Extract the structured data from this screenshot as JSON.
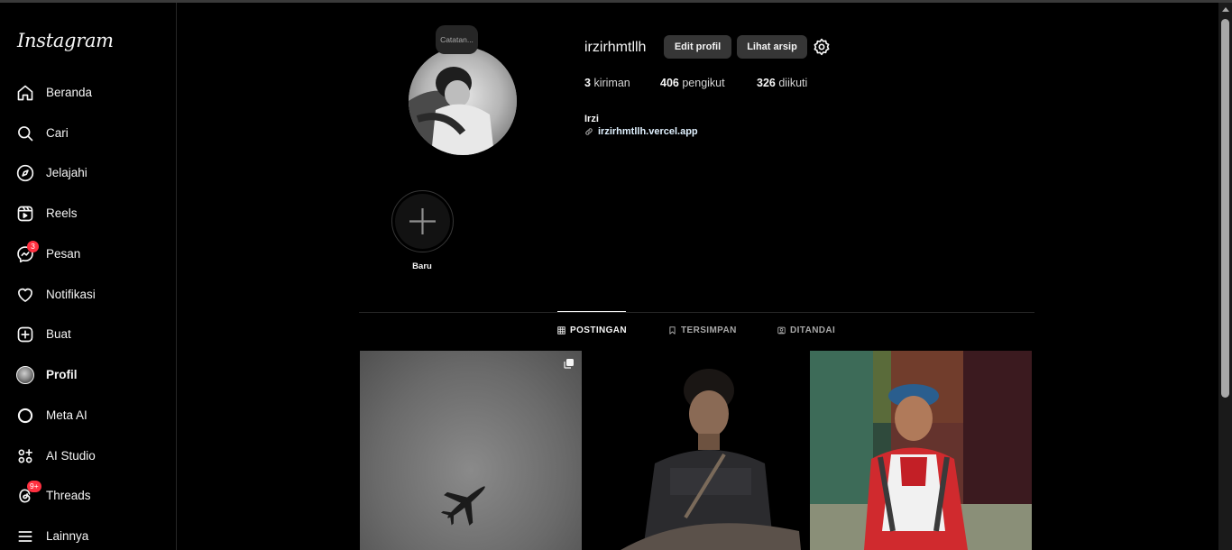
{
  "sidebar": {
    "logo": "Instagram",
    "items": [
      {
        "label": "Beranda",
        "icon": "home-icon"
      },
      {
        "label": "Cari",
        "icon": "search-icon"
      },
      {
        "label": "Jelajahi",
        "icon": "compass-icon"
      },
      {
        "label": "Reels",
        "icon": "reels-icon"
      },
      {
        "label": "Pesan",
        "icon": "messenger-icon",
        "badge": "3"
      },
      {
        "label": "Notifikasi",
        "icon": "heart-icon"
      },
      {
        "label": "Buat",
        "icon": "plus-square-icon"
      },
      {
        "label": "Profil",
        "icon": "avatar"
      },
      {
        "label": "Meta AI",
        "icon": "meta-ai-ring-icon"
      },
      {
        "label": "AI Studio",
        "icon": "ai-studio-icon"
      },
      {
        "label": "Threads",
        "icon": "threads-icon",
        "badge": "9+"
      },
      {
        "label": "Lainnya",
        "icon": "menu-icon"
      }
    ]
  },
  "profile": {
    "note": "Catatan...",
    "username": "irzirhmtllh",
    "edit_label": "Edit profil",
    "archive_label": "Lihat arsip",
    "posts_count": "3",
    "posts_label": "kiriman",
    "followers_count": "406",
    "followers_label": "pengikut",
    "following_count": "326",
    "following_label": "diikuti",
    "full_name": "Irzi",
    "link": "irzirhmtllh.vercel.app"
  },
  "highlight": {
    "new_label": "Baru"
  },
  "tabs": [
    {
      "label": "POSTINGAN",
      "icon": "grid-icon",
      "active": true
    },
    {
      "label": "TERSIMPAN",
      "icon": "bookmark-icon",
      "active": false
    },
    {
      "label": "DITANDAI",
      "icon": "tagged-icon",
      "active": false
    }
  ],
  "colors": {
    "background": "#000000",
    "badge": "#ff3040",
    "button": "#363636"
  }
}
